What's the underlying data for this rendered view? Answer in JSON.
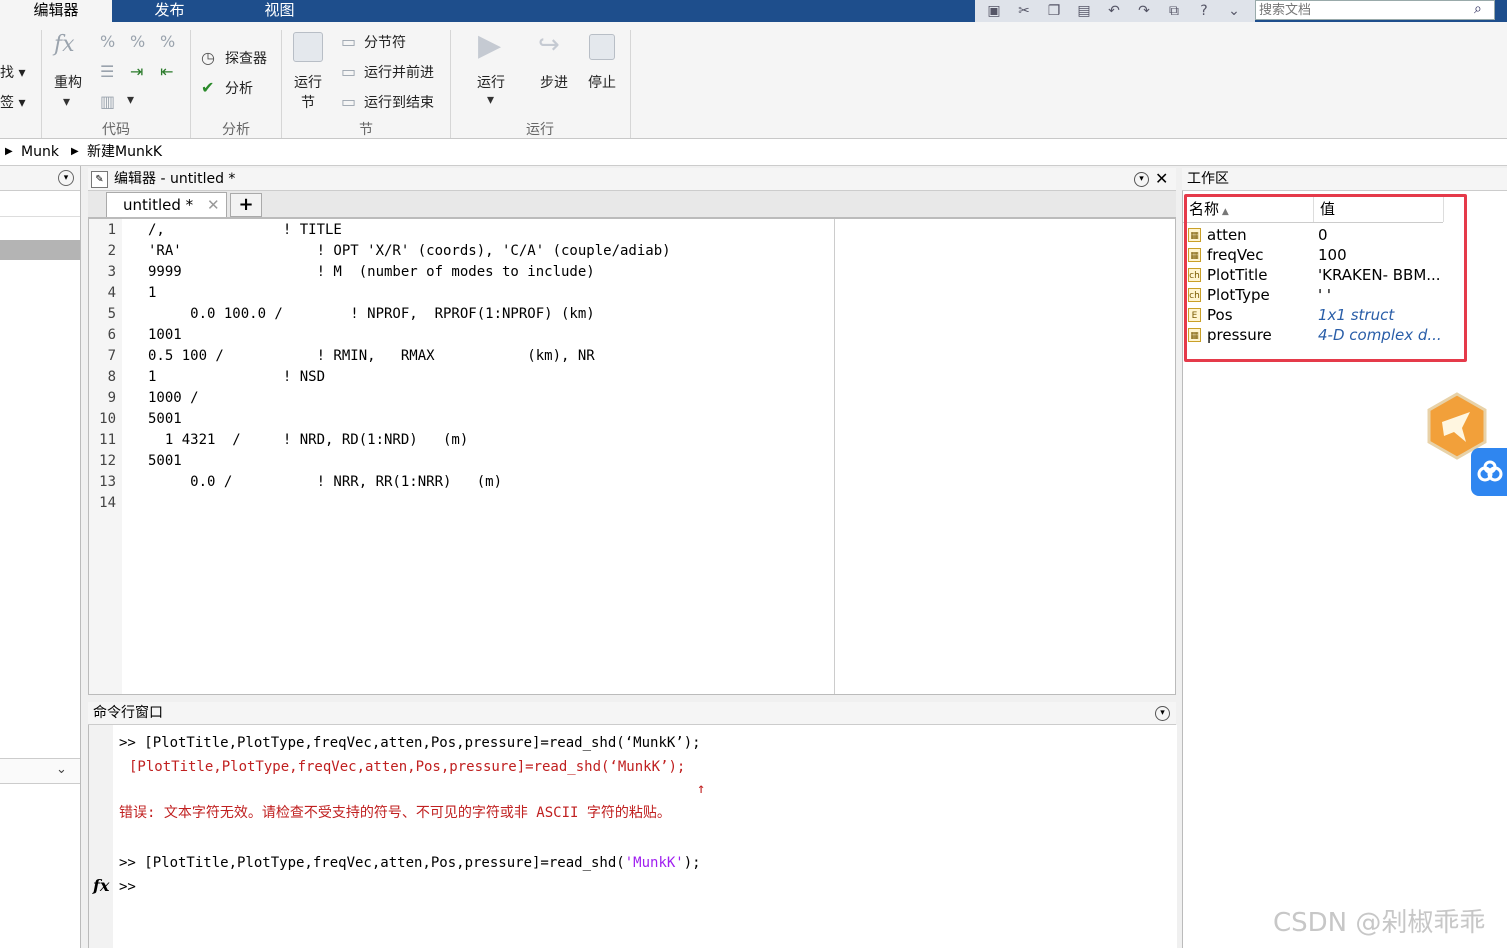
{
  "tabs": {
    "editor": "编辑器",
    "publish": "发布",
    "view": "视图"
  },
  "search": {
    "placeholder": "搜索文档"
  },
  "ribbon": {
    "find_partial": "找",
    "bookmark_partial": "签",
    "refactor": "重构",
    "code_section": "代码",
    "explorer": "探查器",
    "analyze": "分析",
    "analyze_section": "分析",
    "run_section_l1": "运行",
    "run_section_l2": "节",
    "section_break": "分节符",
    "run_and_advance": "运行并前进",
    "run_to_end": "运行到结束",
    "section_section": "节",
    "run": "运行",
    "step": "步进",
    "stop": "停止",
    "run_group": "运行"
  },
  "breadcrumb": {
    "item1": "Munk",
    "item2": "新建MunkK"
  },
  "editor": {
    "title": "编辑器 - untitled *",
    "tab": "untitled *",
    "lines": [
      {
        "n": "1",
        "t": "/,              ! TITLE"
      },
      {
        "n": "2",
        "t": "'RA'                ! OPT 'X/R' (coords), 'C/A' (couple/adiab)"
      },
      {
        "n": "3",
        "t": "9999                ! M  (number of modes to include)"
      },
      {
        "n": "4",
        "t": "1"
      },
      {
        "n": "5",
        "t": "     0.0 100.0 /        ! NPROF,  RPROF(1:NPROF) (km)"
      },
      {
        "n": "6",
        "t": "1001"
      },
      {
        "n": "7",
        "t": "0.5 100 /           ! RMIN,   RMAX           (km), NR"
      },
      {
        "n": "8",
        "t": "1               ! NSD"
      },
      {
        "n": "9",
        "t": "1000 /"
      },
      {
        "n": "10",
        "t": "5001"
      },
      {
        "n": "11",
        "t": "  1 4321  /     ! NRD, RD(1:NRD)   (m)"
      },
      {
        "n": "12",
        "t": "5001"
      },
      {
        "n": "13",
        "t": "     0.0 /          ! NRR, RR(1:NRR)   (m)"
      },
      {
        "n": "14",
        "t": ""
      }
    ]
  },
  "command": {
    "title": "命令行窗口",
    "prompt": ">>",
    "line1": ">> [PlotTitle,PlotType,freqVec,atten,Pos,pressure]=read_shd(‘MunkK’);",
    "error_echo": "[PlotTitle,PlotType,freqVec,atten,Pos,pressure]=read_shd(‘MunkK’);",
    "caret": "↑",
    "error_msg": "错误: 文本字符无效。请检查不受支持的符号、不可见的字符或非 ASCII 字符的粘贴。",
    "line2_prefix": ">> [PlotTitle,PlotType,freqVec,atten,Pos,pressure]=read_shd(",
    "line2_string": "'MunkK'",
    "line2_suffix": ");",
    "fx": "fx"
  },
  "workspace": {
    "title": "工作区",
    "col_name": "名称",
    "col_value": "值",
    "rows": [
      {
        "name": "atten",
        "value": "0"
      },
      {
        "name": "freqVec",
        "value": "100"
      },
      {
        "name": "PlotTitle",
        "value": "'KRAKEN- BBM..."
      },
      {
        "name": "PlotType",
        "value": "'       '"
      },
      {
        "name": "Pos",
        "value": "1x1 struct"
      },
      {
        "name": "pressure",
        "value": "4-D complex d..."
      }
    ]
  },
  "watermark": "CSDN @剁椒乖乖",
  "colors": {
    "tab_blue": "#1e4e8c",
    "error_red": "#c02020",
    "string_purple": "#a020f0",
    "highlight": "#e53a4a"
  }
}
